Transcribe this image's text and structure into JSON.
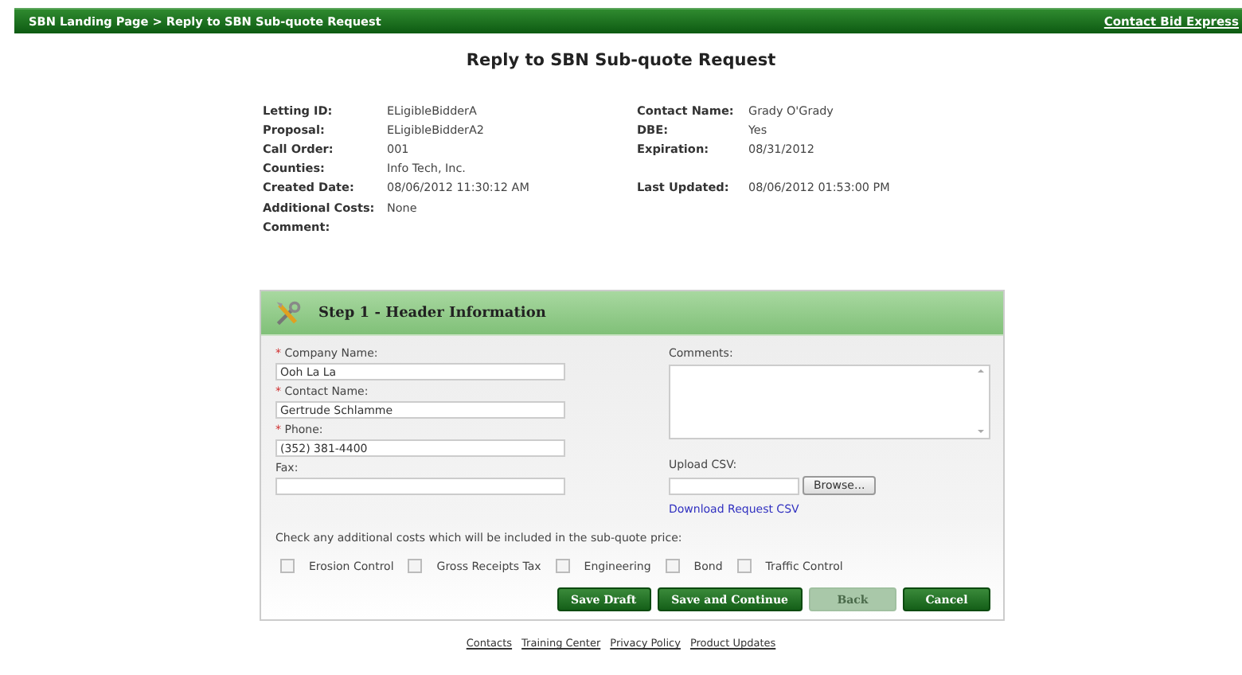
{
  "breadcrumb": {
    "items": [
      "SBN Landing Page",
      "Reply to SBN Sub-quote Request"
    ],
    "separator": ">"
  },
  "header_link": "Contact Bid Express",
  "title": "Reply to SBN Sub-quote Request",
  "details": [
    {
      "left": {
        "label": "Letting ID:",
        "value": "ELigibleBidderA"
      },
      "right": {
        "label": "Contact Name:",
        "value": "Grady O'Grady"
      }
    },
    {
      "left": {
        "label": "Proposal:",
        "value": "ELigibleBidderA2"
      },
      "right": {
        "label": "DBE:",
        "value": "Yes"
      }
    },
    {
      "left": {
        "label": "Call Order:",
        "value": "001"
      },
      "right": {
        "label": "Expiration:",
        "value": "08/31/2012"
      }
    },
    {
      "left": {
        "label": "Counties:",
        "value": "Info Tech, Inc."
      }
    },
    {
      "left": {
        "label": "Created Date:",
        "value": "08/06/2012 11:30:12 AM"
      },
      "right": {
        "label": "Last Updated:",
        "value": "08/06/2012 01:53:00 PM"
      }
    },
    {
      "left": {
        "label": "Additional Costs:",
        "value": "None"
      }
    },
    {
      "left": {
        "label": "Comment:"
      }
    }
  ],
  "step": {
    "title": "Step 1 - Header Information",
    "fields": [
      {
        "label": "Company Name:",
        "required": true,
        "value": "Ooh La La"
      },
      {
        "label": "Contact Name:",
        "required": true,
        "value": "Gertrude Schlamme"
      },
      {
        "label": "Phone:",
        "required": true,
        "value": "(352) 381-4400"
      },
      {
        "label": "Fax:",
        "required": false
      }
    ],
    "required_mark": "*",
    "comments_label": "Comments:",
    "upload_label": "Upload CSV:",
    "browse_button": "Browse...",
    "download_link": "Download Request CSV",
    "costs_prompt": "Check any additional costs which will be included in the sub-quote price:",
    "costs": [
      {
        "label": "Erosion Control",
        "checked": false
      },
      {
        "label": "Gross Receipts Tax",
        "checked": false
      },
      {
        "label": "Engineering",
        "checked": false
      },
      {
        "label": "Bond",
        "checked": false
      },
      {
        "label": "Traffic Control",
        "checked": false
      }
    ],
    "buttons": [
      {
        "label": "Save Draft",
        "disabled": false
      },
      {
        "label": "Save and Continue",
        "disabled": false
      },
      {
        "label": "Back",
        "disabled": true
      },
      {
        "label": "Cancel",
        "disabled": false
      }
    ]
  },
  "footer_links": [
    "Contacts",
    "Training Center",
    "Privacy Policy",
    "Product Updates"
  ]
}
